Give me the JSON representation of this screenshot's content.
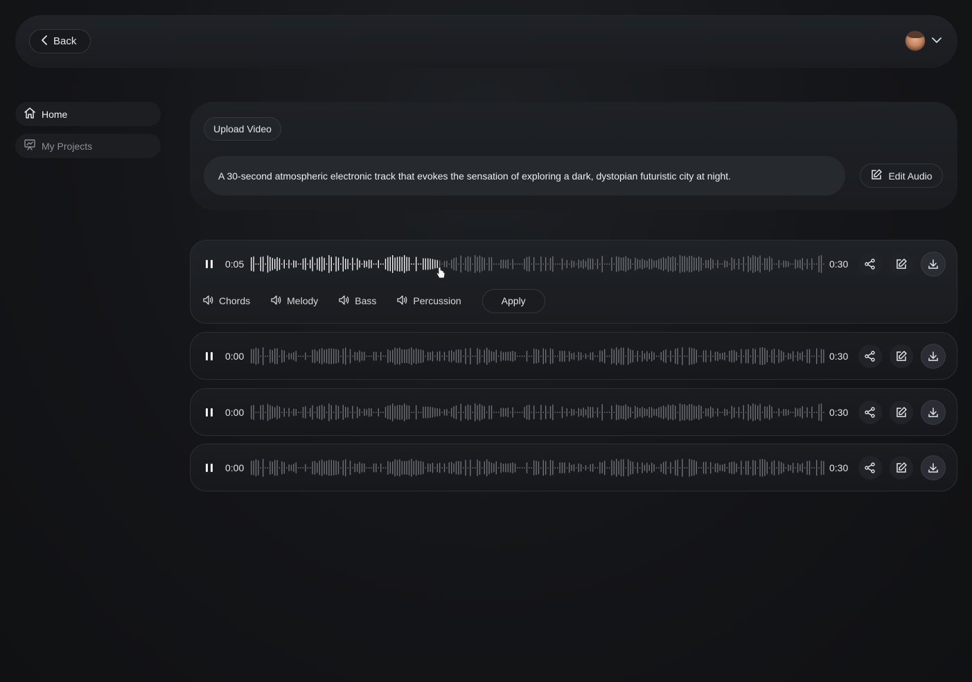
{
  "header": {
    "back_label": "Back",
    "user_icon": "avatar",
    "dropdown_icon": "chevron-down-icon"
  },
  "sidebar": {
    "items": [
      {
        "label": "Home",
        "icon": "home-icon",
        "active": true
      },
      {
        "label": "My Projects",
        "icon": "projects-icon",
        "active": false
      }
    ]
  },
  "prompt": {
    "upload_label": "Upload Video",
    "text": "A 30-second atmospheric electronic track that evokes the sensation of exploring a dark, dystopian futuristic city at night.",
    "edit_audio_label": "Edit Audio"
  },
  "tracks": [
    {
      "current": "0:05",
      "duration": "0:30",
      "progress": 0.327,
      "expanded": true
    },
    {
      "current": "0:00",
      "duration": "0:30",
      "progress": 0,
      "expanded": false
    },
    {
      "current": "0:00",
      "duration": "0:30",
      "progress": 0,
      "expanded": false
    },
    {
      "current": "0:00",
      "duration": "0:30",
      "progress": 0,
      "expanded": false
    }
  ],
  "stems": [
    {
      "label": "Chords"
    },
    {
      "label": "Melody"
    },
    {
      "label": "Bass"
    },
    {
      "label": "Percussion"
    }
  ],
  "apply_label": "Apply",
  "colors": {
    "wave_played": "#f2f3f5",
    "wave_unplayed": "#6d7178",
    "background": "#111214"
  }
}
